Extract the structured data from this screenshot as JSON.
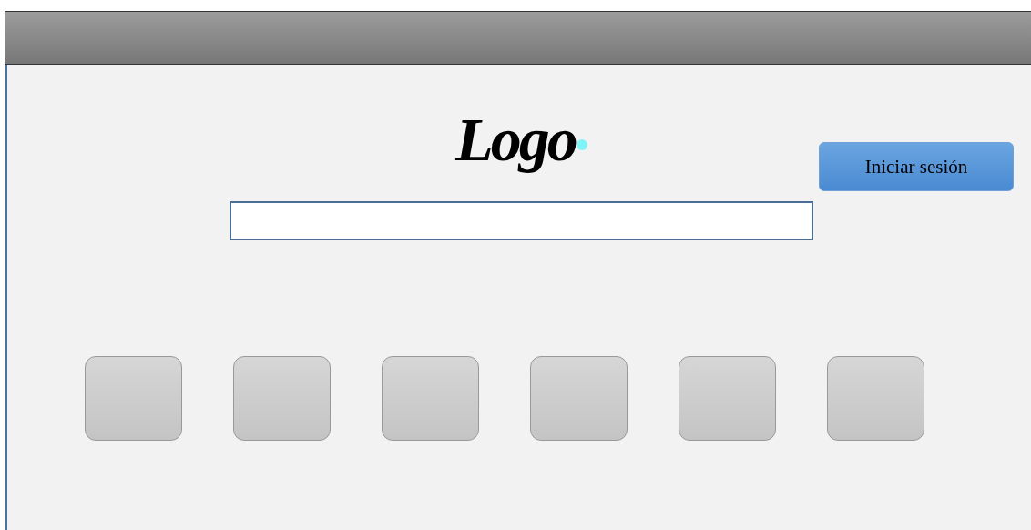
{
  "logo": {
    "text": "Logo"
  },
  "login_button": {
    "label": "Iniciar sesión"
  }
}
